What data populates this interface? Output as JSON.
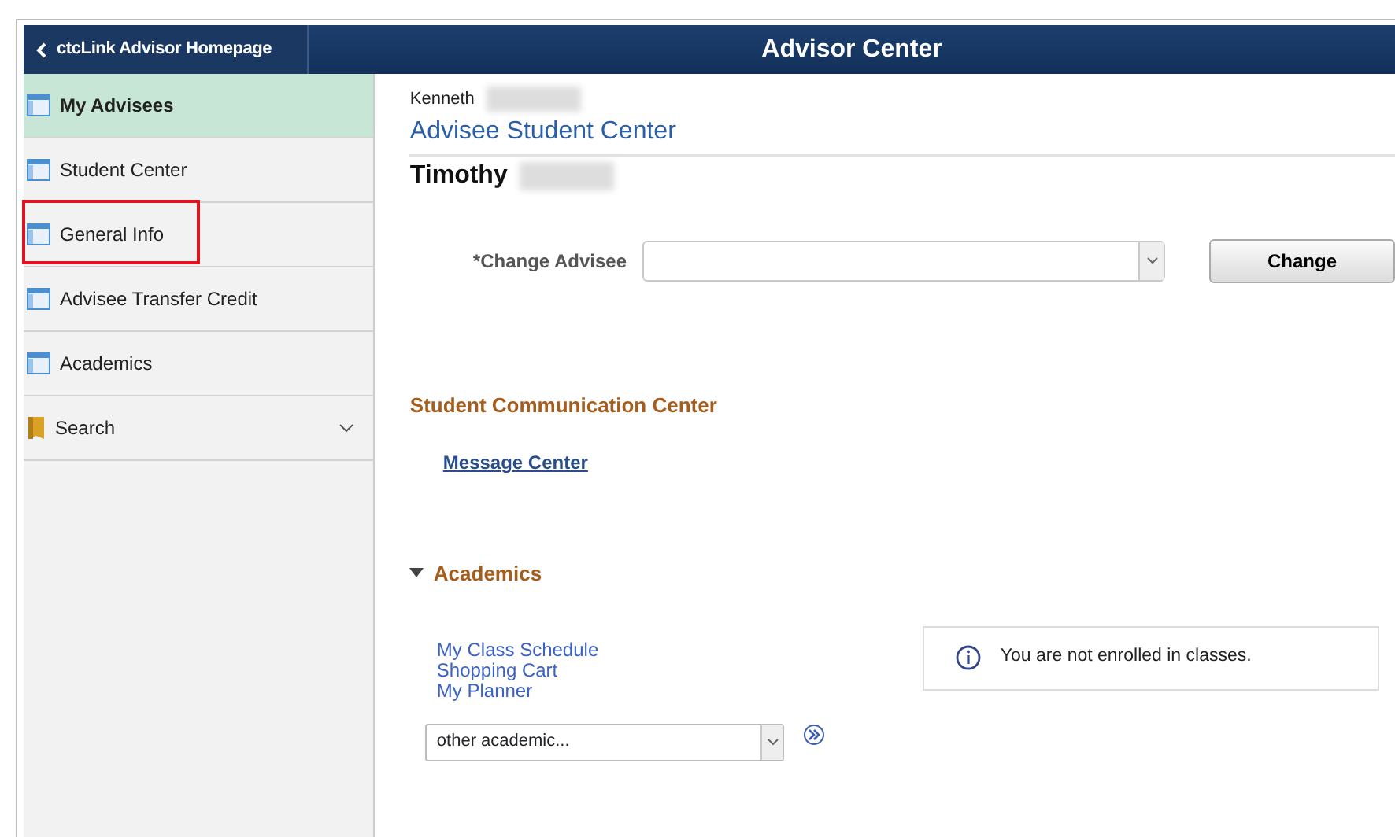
{
  "header": {
    "back_label": "ctcLink Advisor Homepage",
    "title": "Advisor Center"
  },
  "sidebar": {
    "items": [
      {
        "label": "My Advisees",
        "kind": "page",
        "selected": true,
        "highlighted": false
      },
      {
        "label": "Student Center",
        "kind": "page",
        "selected": false,
        "highlighted": false
      },
      {
        "label": "General Info",
        "kind": "page",
        "selected": false,
        "highlighted": true
      },
      {
        "label": "Advisee Transfer Credit",
        "kind": "page",
        "selected": false,
        "highlighted": false
      },
      {
        "label": "Academics",
        "kind": "page",
        "selected": false,
        "highlighted": false
      },
      {
        "label": "Search",
        "kind": "folder",
        "selected": false,
        "highlighted": false,
        "expandable": true
      }
    ]
  },
  "main": {
    "advisor_name": "Kenneth",
    "page_title": "Advisee Student Center",
    "student_name": "Timothy",
    "change_advisee": {
      "label": "*Change Advisee",
      "button": "Change"
    },
    "communication": {
      "heading": "Student Communication Center",
      "link": "Message Center"
    },
    "academics": {
      "heading": "Academics",
      "expanded": true,
      "links": [
        "My Class Schedule",
        "Shopping Cart",
        "My Planner"
      ],
      "notice": "You are not enrolled in classes.",
      "select_value": "other academic..."
    }
  }
}
